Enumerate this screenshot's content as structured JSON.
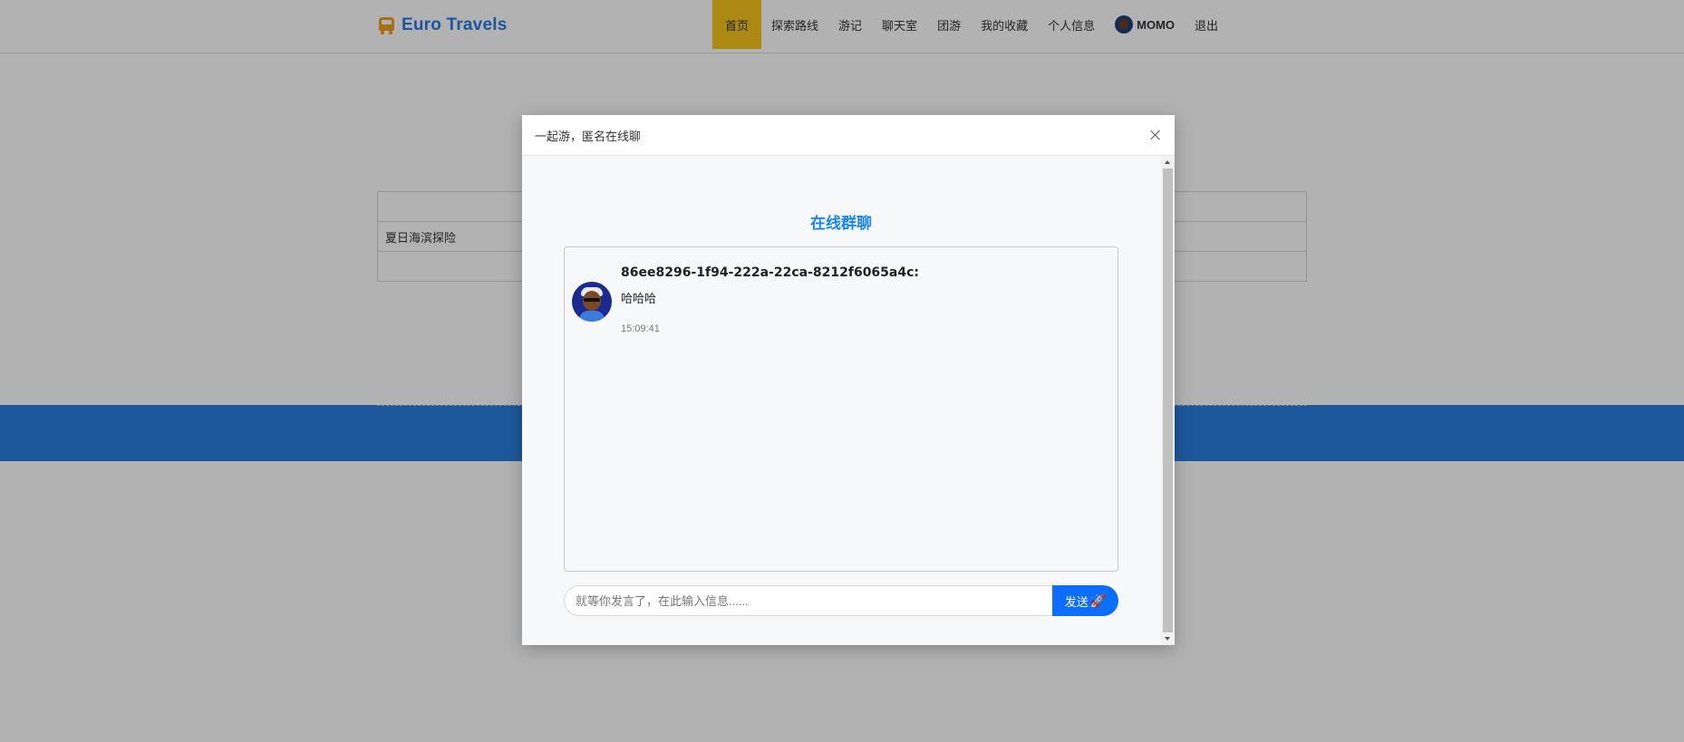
{
  "navbar": {
    "brand": "Euro Travels",
    "items": [
      {
        "label": "首页",
        "active": true
      },
      {
        "label": "探索路线"
      },
      {
        "label": "游记"
      },
      {
        "label": "聊天室"
      },
      {
        "label": "团游"
      },
      {
        "label": "我的收藏"
      },
      {
        "label": "个人信息"
      }
    ],
    "user": "MOMO",
    "logout": "退出"
  },
  "background_table": {
    "rows": [
      [
        ""
      ],
      [
        "夏日海滨探险"
      ],
      [
        ""
      ]
    ]
  },
  "modal": {
    "title": "一起游，匿名在线聊",
    "chat_title": "在线群聊",
    "messages": [
      {
        "user": "86ee8296-1f94-222a-22ca-8212f6065a4c:",
        "text": "哈哈哈",
        "time": "15:09:41"
      }
    ],
    "input": {
      "placeholder": "就等你发言了，在此输入信息......",
      "value": ""
    },
    "send_label": "发送"
  },
  "colors": {
    "brand": "#2a7ae2",
    "active_nav": "#f5c51b",
    "chat_title": "#1a84ee",
    "send_button": "#0d6efd"
  },
  "icons": {
    "brand": "bus-icon",
    "send": "rocket-icon",
    "close": "close-icon"
  }
}
